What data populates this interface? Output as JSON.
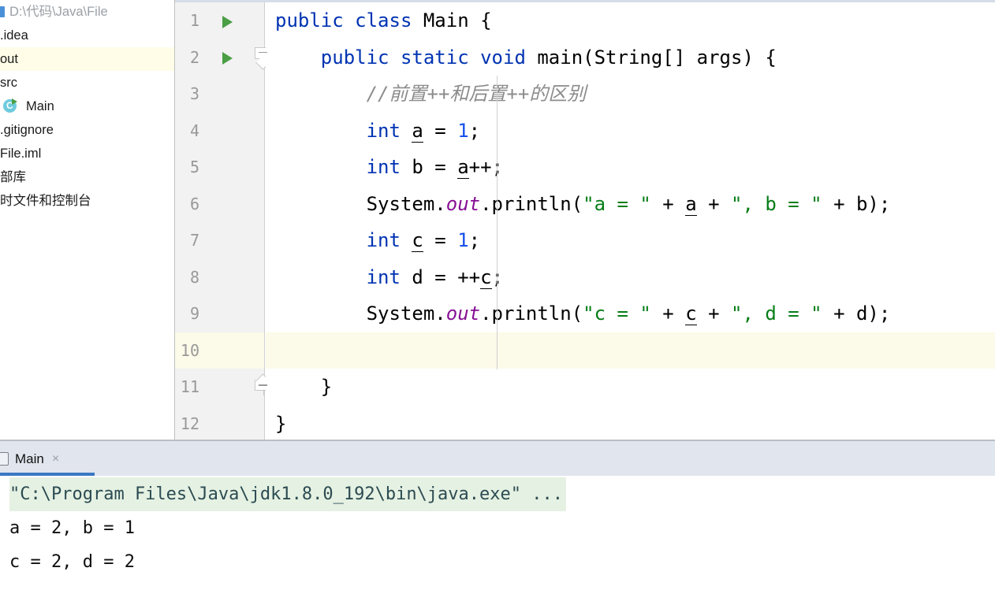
{
  "app": {
    "ide": "IntelliJ IDEA",
    "accent_blue": "#3b78c3",
    "caret_line_color": "#fcfae8",
    "console_highlight_color": "#e5f1e2"
  },
  "sidebar": {
    "items": [
      {
        "label": "D:\\代码\\Java\\File",
        "icon": "project-root-icon",
        "type": "root",
        "selected": false
      },
      {
        "label": ".idea",
        "icon": "folder-icon",
        "type": "folder",
        "selected": false
      },
      {
        "label": "out",
        "icon": "folder-icon",
        "type": "folder",
        "selected": true
      },
      {
        "label": "src",
        "icon": "folder-icon",
        "type": "folder",
        "selected": false
      },
      {
        "label": "Main",
        "icon": "java-class-runnable-icon",
        "type": "class",
        "selected": false
      },
      {
        "label": ".gitignore",
        "icon": "file-icon",
        "type": "file",
        "selected": false
      },
      {
        "label": "File.iml",
        "icon": "iml-file-icon",
        "type": "file",
        "selected": false
      },
      {
        "label": "部库",
        "icon": "external-libraries-icon",
        "type": "node",
        "selected": false
      },
      {
        "label": "时文件和控制台",
        "icon": "scratches-icon",
        "type": "node",
        "selected": false
      }
    ]
  },
  "editor": {
    "caret_line": 10,
    "lines": [
      {
        "number": "1",
        "run_marker": true,
        "fold": "none",
        "tokens": [
          {
            "t": "public ",
            "c": "kw"
          },
          {
            "t": "class ",
            "c": "kw"
          },
          {
            "t": "Main {",
            "c": "pl"
          }
        ]
      },
      {
        "number": "2",
        "run_marker": true,
        "fold": "open",
        "tokens": [
          {
            "t": "    ",
            "c": "pl"
          },
          {
            "t": "public ",
            "c": "kw"
          },
          {
            "t": "static ",
            "c": "kw"
          },
          {
            "t": "void ",
            "c": "kw"
          },
          {
            "t": "main(String[] args) {",
            "c": "pl"
          }
        ]
      },
      {
        "number": "3",
        "run_marker": false,
        "fold": "none",
        "tokens": [
          {
            "t": "        ",
            "c": "pl"
          },
          {
            "t": "//前置++和后置++的区别",
            "c": "cmt"
          }
        ]
      },
      {
        "number": "4",
        "run_marker": false,
        "fold": "none",
        "tokens": [
          {
            "t": "        ",
            "c": "pl"
          },
          {
            "t": "int ",
            "c": "kw"
          },
          {
            "t": "a",
            "c": "var"
          },
          {
            "t": " = ",
            "c": "pl"
          },
          {
            "t": "1",
            "c": "num"
          },
          {
            "t": ";",
            "c": "pl"
          }
        ]
      },
      {
        "number": "5",
        "run_marker": false,
        "fold": "none",
        "tokens": [
          {
            "t": "        ",
            "c": "pl"
          },
          {
            "t": "int ",
            "c": "kw"
          },
          {
            "t": "b = ",
            "c": "pl"
          },
          {
            "t": "a",
            "c": "var"
          },
          {
            "t": "++;",
            "c": "pl"
          }
        ]
      },
      {
        "number": "6",
        "run_marker": false,
        "fold": "none",
        "tokens": [
          {
            "t": "        ",
            "c": "pl"
          },
          {
            "t": "System.",
            "c": "pl"
          },
          {
            "t": "out",
            "c": "fld"
          },
          {
            "t": ".println(",
            "c": "pl"
          },
          {
            "t": "\"a = \"",
            "c": "str"
          },
          {
            "t": " + ",
            "c": "pl"
          },
          {
            "t": "a",
            "c": "var"
          },
          {
            "t": " + ",
            "c": "pl"
          },
          {
            "t": "\", b = \"",
            "c": "str"
          },
          {
            "t": " + b);",
            "c": "pl"
          }
        ]
      },
      {
        "number": "7",
        "run_marker": false,
        "fold": "none",
        "tokens": [
          {
            "t": "        ",
            "c": "pl"
          },
          {
            "t": "int ",
            "c": "kw"
          },
          {
            "t": "c",
            "c": "var"
          },
          {
            "t": " = ",
            "c": "pl"
          },
          {
            "t": "1",
            "c": "num"
          },
          {
            "t": ";",
            "c": "pl"
          }
        ]
      },
      {
        "number": "8",
        "run_marker": false,
        "fold": "none",
        "tokens": [
          {
            "t": "        ",
            "c": "pl"
          },
          {
            "t": "int ",
            "c": "kw"
          },
          {
            "t": "d = ++",
            "c": "pl"
          },
          {
            "t": "c",
            "c": "var"
          },
          {
            "t": ";",
            "c": "pl"
          }
        ]
      },
      {
        "number": "9",
        "run_marker": false,
        "fold": "none",
        "tokens": [
          {
            "t": "        ",
            "c": "pl"
          },
          {
            "t": "System.",
            "c": "pl"
          },
          {
            "t": "out",
            "c": "fld"
          },
          {
            "t": ".println(",
            "c": "pl"
          },
          {
            "t": "\"c = \"",
            "c": "str"
          },
          {
            "t": " + ",
            "c": "pl"
          },
          {
            "t": "c",
            "c": "var"
          },
          {
            "t": " + ",
            "c": "pl"
          },
          {
            "t": "\", d = \"",
            "c": "str"
          },
          {
            "t": " + d);",
            "c": "pl"
          }
        ]
      },
      {
        "number": "10",
        "run_marker": false,
        "fold": "none",
        "tokens": []
      },
      {
        "number": "11",
        "run_marker": false,
        "fold": "end",
        "tokens": [
          {
            "t": "    }",
            "c": "pl"
          }
        ]
      },
      {
        "number": "12",
        "run_marker": false,
        "fold": "none",
        "tokens": [
          {
            "t": "}",
            "c": "pl"
          }
        ]
      }
    ]
  },
  "run_panel": {
    "tab": {
      "label": "Main",
      "icon": "run-configuration-icon",
      "close_label": "×",
      "active": true
    },
    "console": [
      {
        "text": "\"C:\\Program Files\\Java\\jdk1.8.0_192\\bin\\java.exe\" ...",
        "highlight": true
      },
      {
        "text": "a = 2, b = 1",
        "highlight": false
      },
      {
        "text": "c = 2, d = 2",
        "highlight": false
      }
    ]
  }
}
